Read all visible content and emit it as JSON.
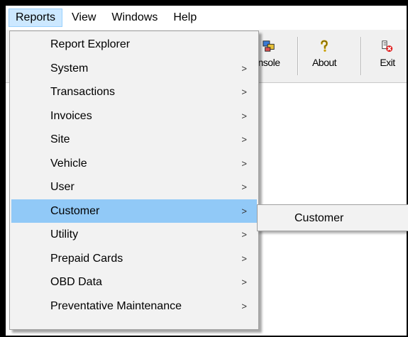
{
  "menubar": {
    "items": [
      {
        "label": "Reports",
        "active": true
      },
      {
        "label": "View"
      },
      {
        "label": "Windows"
      },
      {
        "label": "Help"
      }
    ]
  },
  "toolbar": {
    "console_label": "nsole",
    "about_label": "About",
    "exit_label": "Exit",
    "console_icon": "console-icon",
    "about_icon": "question-mark-icon",
    "exit_icon": "exit-icon"
  },
  "reports_menu": {
    "items": [
      {
        "label": "Report Explorer",
        "has_submenu": false
      },
      {
        "label": "System",
        "has_submenu": true
      },
      {
        "label": "Transactions",
        "has_submenu": true
      },
      {
        "label": "Invoices",
        "has_submenu": true
      },
      {
        "label": "Site",
        "has_submenu": true
      },
      {
        "label": "Vehicle",
        "has_submenu": true
      },
      {
        "label": "User",
        "has_submenu": true
      },
      {
        "label": "Customer",
        "has_submenu": true,
        "highlighted": true
      },
      {
        "label": "Utility",
        "has_submenu": true
      },
      {
        "label": "Prepaid Cards",
        "has_submenu": true
      },
      {
        "label": "OBD Data",
        "has_submenu": true
      },
      {
        "label": "Preventative Maintenance",
        "has_submenu": true
      }
    ],
    "arrow": ">"
  },
  "customer_submenu": {
    "items": [
      {
        "label": "Customer"
      }
    ]
  },
  "colors": {
    "highlight": "#91c9f7",
    "menu_bg": "#f2f2f2",
    "menubar_active": "#cce8ff"
  }
}
